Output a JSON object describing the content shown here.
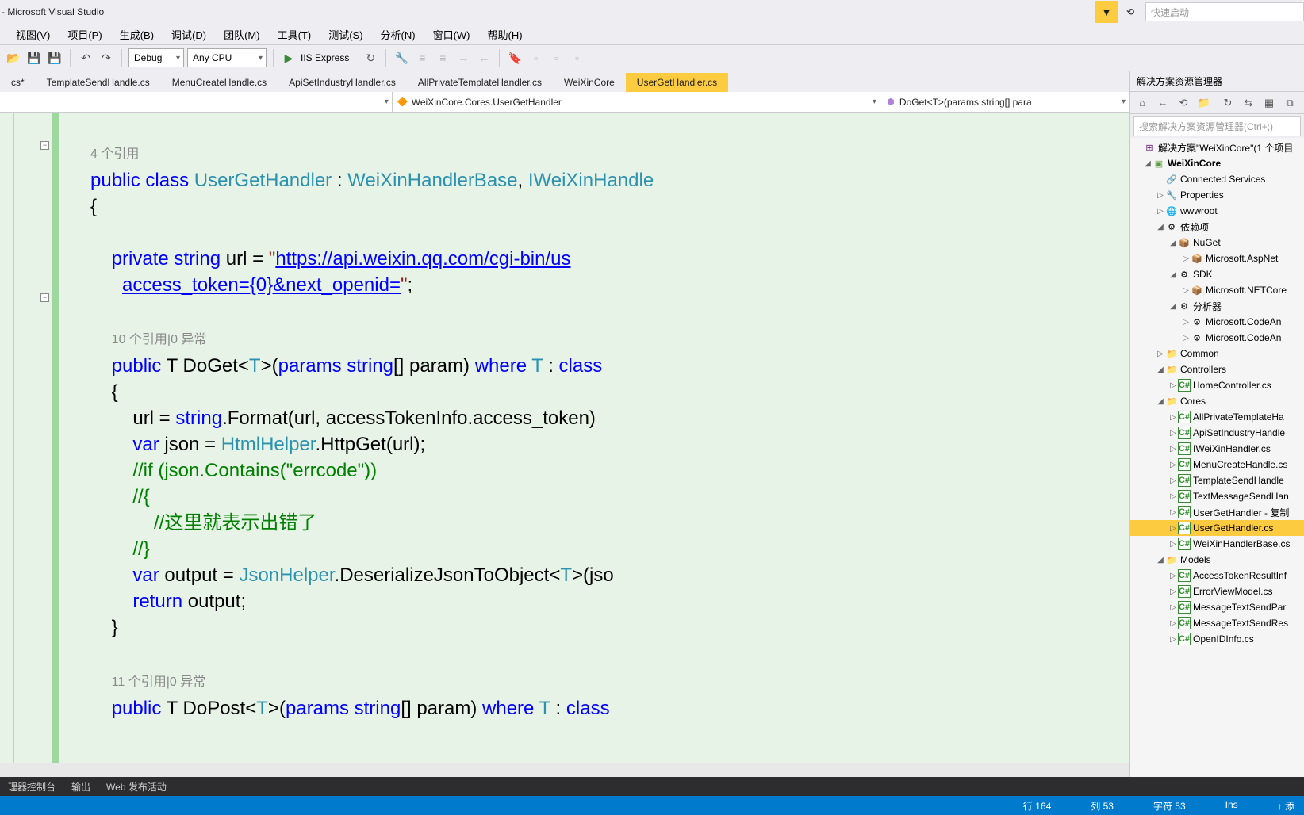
{
  "title": " - Microsoft Visual Studio",
  "quickLaunch": "快速启动",
  "menu": [
    "视图(V)",
    "项目(P)",
    "生成(B)",
    "调试(D)",
    "团队(M)",
    "工具(T)",
    "测试(S)",
    "分析(N)",
    "窗口(W)",
    "帮助(H)"
  ],
  "toolbar": {
    "config": "Debug",
    "platform": "Any CPU",
    "run": "IIS Express"
  },
  "tabs": [
    "cs*",
    "TemplateSendHandle.cs",
    "MenuCreateHandle.cs",
    "ApiSetIndustryHandler.cs",
    "AllPrivateTemplateHandler.cs",
    "WeiXinCore",
    "UserGetHandler.cs"
  ],
  "activeTab": 6,
  "nav": {
    "left": "",
    "mid": "WeiXinCore.Cores.UserGetHandler",
    "right": "DoGet<T>(params string[] para"
  },
  "code": {
    "cl1": "4 个引用",
    "l1a": "public",
    "l1b": "class",
    "l1c": "UserGetHandler",
    "l1d": ":",
    "l1e": "WeiXinHandlerBase",
    "l1f": ",",
    "l1g": "IWeiXinHandle",
    "l2": "{",
    "l3a": "private",
    "l3b": "string",
    "l3c": "url =",
    "l3d": "\"",
    "l3e": "https://api.weixin.qq.com/cgi-bin/us",
    "l4a": "access_token={0}&next_openid=",
    "l4b": "\"",
    "l4c": ";",
    "cl2": "10 个引用|0 异常",
    "l5a": "public",
    "l5b": "T DoGet<",
    "l5c": "T",
    "l5d": ">(",
    "l5e": "params",
    "l5f": "string",
    "l5g": "[] param)",
    "l5h": "where",
    "l5i": "T",
    "l5j": ":",
    "l5k": "class",
    "l6": "{",
    "l7a": "url =",
    "l7b": "string",
    "l7c": ".Format(url, accessTokenInfo.access_token)",
    "l8a": "var",
    "l8b": "json =",
    "l8c": "HtmlHelper",
    "l8d": ".HttpGet(url);",
    "l9": "//if (json.Contains(\"errcode\"))",
    "l10": "//{",
    "l11": "    //这里就表示出错了",
    "l12": "//}",
    "l13a": "var",
    "l13b": "output =",
    "l13c": "JsonHelper",
    "l13d": ".DeserializeJsonToObject<",
    "l13e": "T",
    "l13f": ">(jso",
    "l14a": "return",
    "l14b": "output;",
    "l15": "}",
    "cl3": "11 个引用|0 异常",
    "l16a": "public",
    "l16b": "T DoPost<",
    "l16c": "T",
    "l16d": ">(",
    "l16e": "params",
    "l16f": "string",
    "l16g": "[] param)",
    "l16h": "where",
    "l16i": "T",
    "l16j": ":",
    "l16k": "class"
  },
  "solution": {
    "title": "解决方案资源管理器",
    "search": "搜索解决方案资源管理器(Ctrl+;)",
    "root": "解决方案\"WeiXinCore\"(1 个项目",
    "project": "WeiXinCore",
    "items": {
      "conn": "Connected Services",
      "prop": "Properties",
      "www": "wwwroot",
      "deps": "依赖项",
      "nuget": "NuGet",
      "aspnet": "Microsoft.AspNet",
      "sdk": "SDK",
      "netcore": "Microsoft.NETCore",
      "analyzer": "分析器",
      "codean1": "Microsoft.CodeAn",
      "codean2": "Microsoft.CodeAn",
      "common": "Common",
      "controllers": "Controllers",
      "homectl": "HomeController.cs",
      "cores": "Cores",
      "f1": "AllPrivateTemplateHa",
      "f2": "ApiSetIndustryHandle",
      "f3": "IWeiXinHandler.cs",
      "f4": "MenuCreateHandle.cs",
      "f5": "TemplateSendHandle",
      "f6": "TextMessageSendHan",
      "f7": "UserGetHandler - 复制",
      "f8": "UserGetHandler.cs",
      "f9": "WeiXinHandlerBase.cs",
      "models": "Models",
      "m1": "AccessTokenResultInf",
      "m2": "ErrorViewModel.cs",
      "m3": "MessageTextSendPar",
      "m4": "MessageTextSendRes",
      "m5": "OpenIDInfo.cs"
    }
  },
  "bottomTabs": [
    "理器控制台",
    "输出",
    "Web 发布活动"
  ],
  "status": {
    "line": "行 164",
    "col": "列 53",
    "char": "字符 53",
    "ins": "Ins",
    "add": "↑ 添"
  }
}
